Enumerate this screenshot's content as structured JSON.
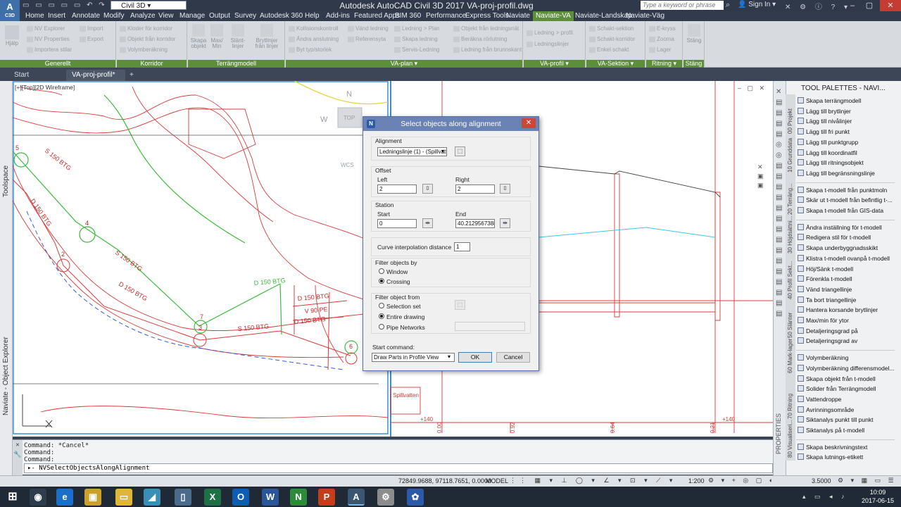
{
  "titlebar": {
    "app_name": "Civil 3D",
    "title": "Autodesk AutoCAD Civil 3D 2017    VA-proj-profil.dwg",
    "search_placeholder": "Type a keyword or phrase",
    "sign_in": "Sign In",
    "logo_text": "C3D"
  },
  "menu": {
    "tabs": [
      "Home",
      "Insert",
      "Annotate",
      "Modify",
      "Analyze",
      "View",
      "Manage",
      "Output",
      "Survey",
      "Autodesk 360",
      "Help",
      "Add-ins",
      "Featured Apps",
      "BIM 360",
      "Performance",
      "Express Tools",
      "Naviate",
      "Naviate-VA",
      "Naviate-Landskap",
      "Naviate-Väg"
    ],
    "active": "Naviate-VA"
  },
  "ribbon": {
    "panels": [
      {
        "title": "Generellt",
        "items": [
          "NV Explorer",
          "NV Properties",
          "Importera stilar",
          "Import",
          "Export"
        ],
        "big": "Hjälp"
      },
      {
        "title": "Korridor",
        "items": [
          "Kloder för korridor",
          "Objekt från korridor",
          "Volymberäkning"
        ]
      },
      {
        "title": "Terrängmodell",
        "items": [
          "Skapa objekt",
          "Max/ Min",
          "Slänt-linjer",
          "Brytlinjer från linjer"
        ]
      },
      {
        "title": "VA-plan",
        "items": [
          "Kollisionskontroll",
          "Ändra anslutning",
          "Byt typ/storlek",
          "Vänd ledning",
          "Referensyta",
          "Ledning > Plan",
          "Skapa ledning",
          "Servis-Ledning",
          "Objekt från ledningsnät",
          "Beräkna rörlutning",
          "Ledning från brunnskant"
        ]
      },
      {
        "title": "VA-profil",
        "items": [
          "Ledning > profil",
          "Ledningslinjer"
        ]
      },
      {
        "title": "VA-Sektion",
        "items": [
          "Schakt-sektion",
          "Schakt-korridor",
          "Enkel schakt"
        ]
      },
      {
        "title": "Ritning",
        "items": [
          "E-kryss",
          "Zooma",
          "Lager"
        ]
      },
      {
        "title": "Stäng",
        "items": [
          "Stäng"
        ]
      }
    ]
  },
  "doc_tabs": [
    "Start",
    "VA-proj-profil*"
  ],
  "viewport": {
    "label": "[+][Top][2D Wireframe]",
    "viewcube_top": "TOP",
    "wcs": "WCS",
    "compass_n": "N",
    "compass_w": "W",
    "annotations": [
      "S 150 BTG",
      "D 150 BTG",
      "S 150 BTG",
      "D 150 BTG",
      "S 150 BTG",
      "D 150 BTG",
      "V 90 PE",
      "D 150 BTG",
      "D 150 BTG"
    ],
    "manholes": [
      "5",
      "4",
      "2",
      "7",
      "3",
      "6"
    ],
    "profile_labels": [
      "Spillvatten",
      "+140",
      "+140"
    ],
    "station_labels": [
      "0.00",
      "0.92",
      "0.64",
      "0.21"
    ]
  },
  "left_panels": [
    "Toolspace",
    "Naviate - Object Explorer"
  ],
  "command": {
    "history": [
      "Command: *Cancel*",
      "Command:",
      "Command:"
    ],
    "current": "NVSelectObjectsAlongAlignment"
  },
  "status": {
    "coords": "72849.9688, 97118.7651, 0.0000",
    "model": "MODEL",
    "scale": "1:200",
    "value": "3.5000"
  },
  "taskbar": {
    "time": "10:09",
    "date": "2017-06-15"
  },
  "tool_palettes": {
    "title": "TOOL PALETTES - NAVI...",
    "properties_label": "PROPERTIES",
    "side_tabs": [
      "00 Projekt",
      "10 Grunddata",
      "20 Terräng...",
      "30 Höjdsättni...",
      "40 Profil Sekt...",
      "50 Slänter",
      "60 Mark-lager",
      "70 Ritning",
      "80 Visualiseri..."
    ],
    "groups": [
      [
        "Skapa terrängmodell",
        "Lägg till brytlinjer",
        "Lägg till nivålinjer",
        "Lägg till fri punkt",
        "Lägg till punktgrupp",
        "Lägg till koordinatfil",
        "Lägg till ritningsobjekt",
        "Lägg till begränsningslinje"
      ],
      [
        "Skapa t-modell från punktmoln",
        "Skär ut t-modell från befintlig t-...",
        "Skapa t-modell från GIS-data"
      ],
      [
        "Ändra inställning för t-modell",
        "Redigera stil för t-modell",
        "Skapa underbyggnadsskikt",
        "Klistra t-modell ovanpå t-modell",
        "Höj/Sänk t-modell",
        "Förenkla t-modell",
        "Vänd triangellinje",
        "Ta bort triangellinje",
        "Hantera korsande brytlinjer",
        "Max/min för ytor",
        "Detaljeringsgrad på",
        "Detaljeringsgrad av"
      ],
      [
        "Volymberäkning",
        "Volymberäkning  differensmodel...",
        "Skapa objekt från t-modell",
        "Solider från Terrängmodell",
        "Vattendroppe",
        "Avrinningsområde",
        "Siktanalys punkt till punkt",
        "Siktanalys på t-modell"
      ],
      [
        "Skapa beskrivningstext",
        "Skapa lutnings-etikett"
      ]
    ]
  },
  "dialog": {
    "title": "Select objects along alignment",
    "alignment_label": "Alignment",
    "alignment_value": "Ledningslinje (1) - (Spillvatt",
    "offset_label": "Offset",
    "left_label": "Left",
    "left_value": "2",
    "right_label": "Right",
    "right_value": "2",
    "station_label": "Station",
    "start_label": "Start",
    "start_value": "0",
    "end_label": "End",
    "end_value": "40.21295673885",
    "curve_label": "Curve interpolation distance",
    "curve_value": "1",
    "filter_by_label": "Filter objects by",
    "filter_by_options": [
      "Window",
      "Crossing"
    ],
    "filter_by_selected": "Crossing",
    "filter_from_label": "Filter object from",
    "filter_from_options": [
      "Selection set",
      "Entire drawing",
      "Pipe Networks"
    ],
    "filter_from_selected": "Entire drawing",
    "start_command_label": "Start command:",
    "start_command_value": "Draw Parts in Profile View",
    "ok": "OK",
    "cancel": "Cancel"
  }
}
